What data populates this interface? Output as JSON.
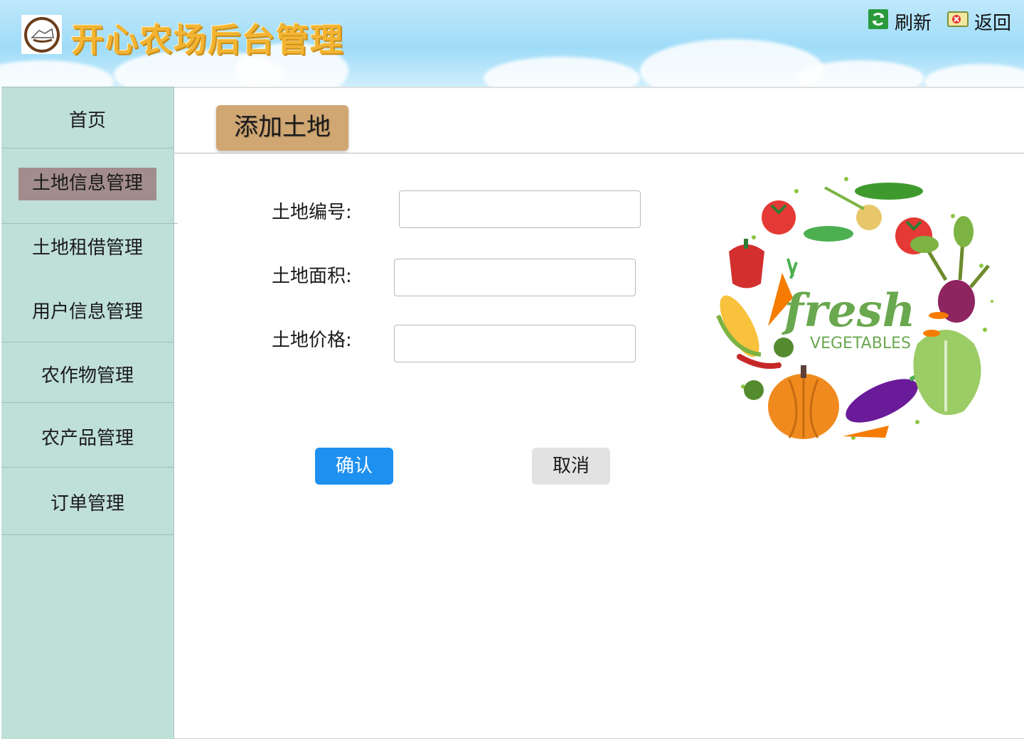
{
  "app": {
    "title": "开心农场后台管理"
  },
  "top_actions": [
    {
      "label": "刷新",
      "icon": "refresh-icon"
    },
    {
      "label": "返回",
      "icon": "back-icon"
    }
  ],
  "sidebar": {
    "items": [
      {
        "label": "首页",
        "active": false
      },
      {
        "label": "土地信息管理",
        "active": true
      },
      {
        "label": "土地租借管理",
        "active": false
      },
      {
        "label": "用户信息管理",
        "active": false
      },
      {
        "label": "农作物管理",
        "active": false
      },
      {
        "label": "农产品管理",
        "active": false
      },
      {
        "label": "订单管理",
        "active": false
      }
    ]
  },
  "page": {
    "title": "添加土地"
  },
  "form": {
    "fields": [
      {
        "label": "土地编号:",
        "value": "",
        "placeholder": ""
      },
      {
        "label": "土地面积:",
        "value": "",
        "placeholder": ""
      },
      {
        "label": "土地价格:",
        "value": "",
        "placeholder": ""
      }
    ],
    "confirm_label": "确认",
    "cancel_label": "取消"
  },
  "illustration": {
    "headline": "fresh",
    "subline": "VEGETABLES"
  },
  "colors": {
    "sidebar_bg": "#bfdfd9",
    "active_item_bg": "#a28c8c",
    "page_title_bg": "#d0a773",
    "confirm_bg": "#1e90ef",
    "cancel_bg": "#e2e2e2",
    "title_color": "#f2b432"
  }
}
